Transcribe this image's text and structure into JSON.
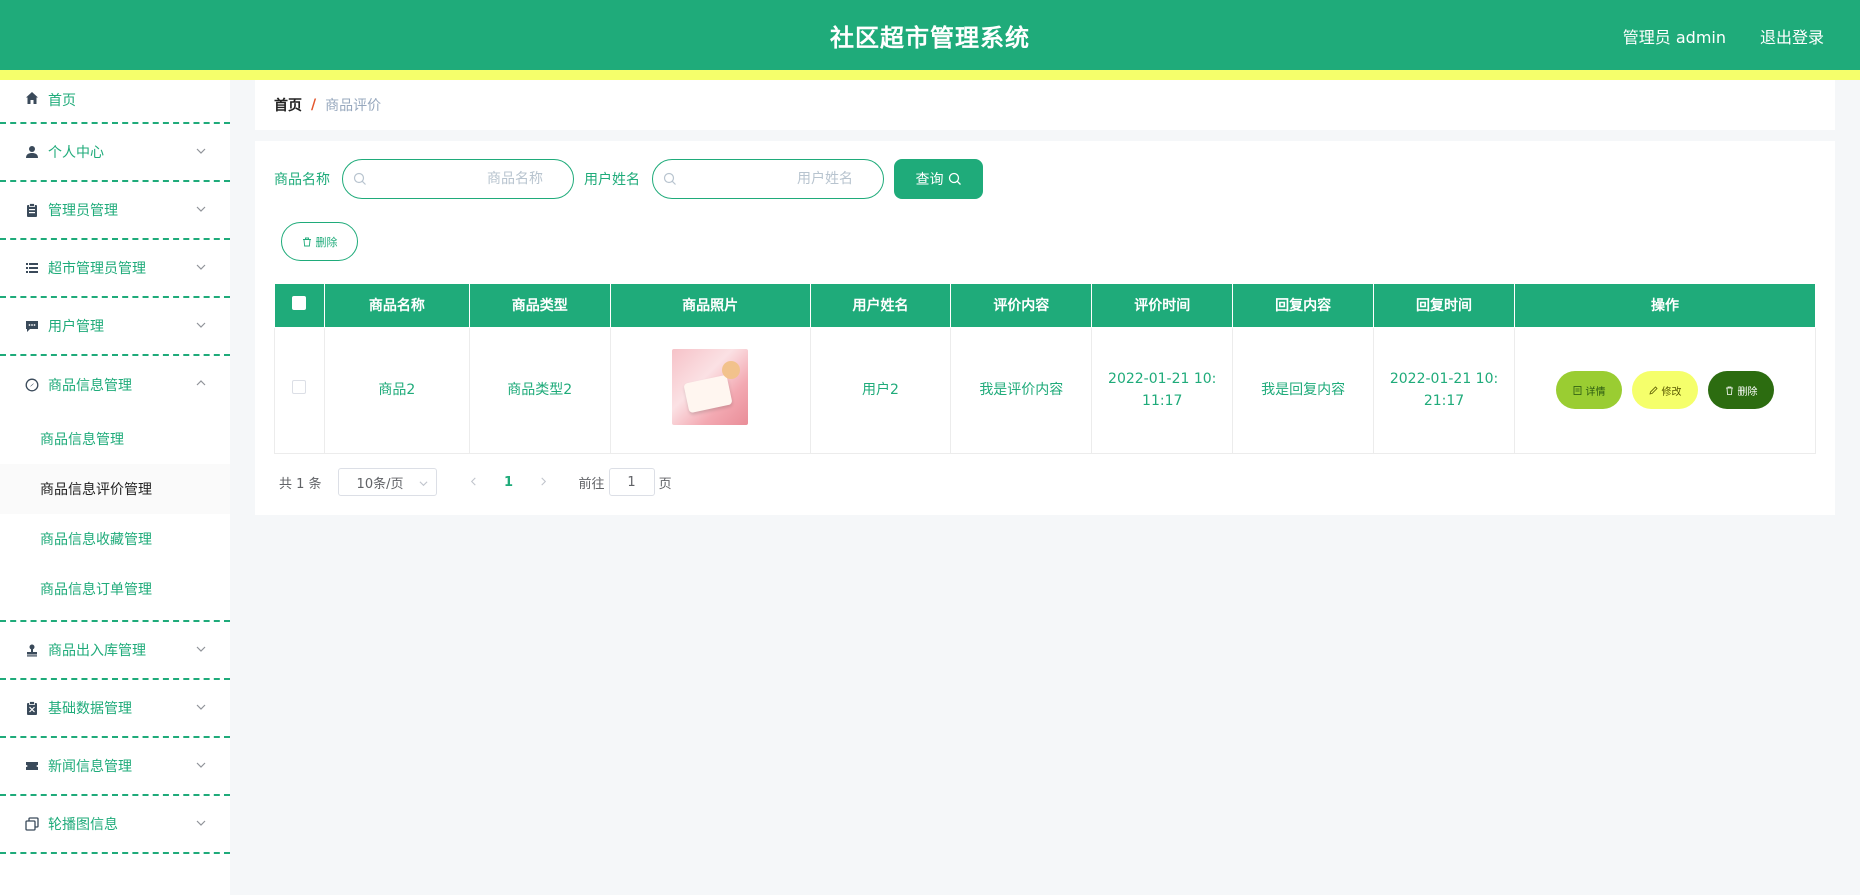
{
  "header": {
    "title": "社区超市管理系统",
    "user": "管理员 admin",
    "logout": "退出登录",
    "accent": "#1fab7a",
    "stripe": "#f5ff6b"
  },
  "sidebar": {
    "items": [
      {
        "label": "首页",
        "icon": "home-icon"
      },
      {
        "label": "个人中心",
        "icon": "user-icon"
      },
      {
        "label": "管理员管理",
        "icon": "clipboard-icon"
      },
      {
        "label": "超市管理员管理",
        "icon": "list-icon"
      },
      {
        "label": "用户管理",
        "icon": "chat-icon"
      },
      {
        "label": "商品信息管理",
        "icon": "compass-icon",
        "open": true,
        "children": [
          "商品信息管理",
          "商品信息评价管理",
          "商品信息收藏管理",
          "商品信息订单管理"
        ]
      },
      {
        "label": "商品出入库管理",
        "icon": "stamp-icon"
      },
      {
        "label": "基础数据管理",
        "icon": "trash-clipboard-icon"
      },
      {
        "label": "新闻信息管理",
        "icon": "ticket-icon"
      },
      {
        "label": "轮播图信息",
        "icon": "copy-icon"
      }
    ],
    "active_child": "商品信息评价管理"
  },
  "breadcrumb": {
    "home": "首页",
    "separator": "/",
    "current": "商品评价"
  },
  "search": {
    "product_label": "商品名称",
    "product_placeholder": "商品名称",
    "user_label": "用户姓名",
    "user_placeholder": "用户姓名",
    "query_label": "查询"
  },
  "toolbar": {
    "delete_label": "删除"
  },
  "table": {
    "columns": [
      "商品名称",
      "商品类型",
      "商品照片",
      "用户姓名",
      "评价内容",
      "评价时间",
      "回复内容",
      "回复时间",
      "操作"
    ],
    "rows": [
      {
        "product_name": "商品2",
        "product_type": "商品类型2",
        "user_name": "用户2",
        "review": "我是评价内容",
        "review_time": "2022-01-21 10:11:17",
        "reply": "我是回复内容",
        "reply_time": "2022-01-21 10:21:17"
      }
    ],
    "actions": {
      "detail": "详情",
      "edit": "修改",
      "delete": "删除"
    }
  },
  "pagination": {
    "total": "共 1 条",
    "page_size": "10条/页",
    "current_page": "1",
    "goto_label": "前往",
    "goto_value": "1",
    "unit": "页"
  }
}
